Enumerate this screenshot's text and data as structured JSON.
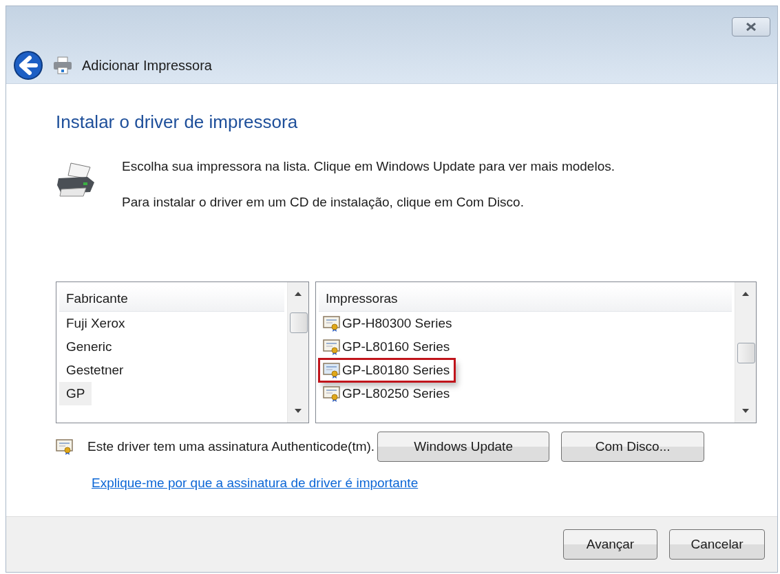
{
  "window": {
    "title": "Adicionar Impressora"
  },
  "heading": "Instalar o driver de impressora",
  "intro": [
    "Escolha sua impressora na lista. Clique em Windows Update para ver mais modelos.",
    "Para instalar o driver em um CD de instalação, clique em Com Disco."
  ],
  "manufacturers": {
    "header": "Fabricante",
    "items": [
      {
        "label": "Fuji Xerox",
        "selected": false
      },
      {
        "label": "Generic",
        "selected": false
      },
      {
        "label": "Gestetner",
        "selected": false
      },
      {
        "label": "GP",
        "selected": true
      }
    ]
  },
  "printers": {
    "header": "Impressoras",
    "items": [
      {
        "label": "GP-H80300 Series",
        "selected": false
      },
      {
        "label": "GP-L80160 Series",
        "selected": false
      },
      {
        "label": "GP-L80180 Series",
        "selected": true
      },
      {
        "label": "GP-L80250 Series",
        "selected": false
      }
    ]
  },
  "signature_note": "Este driver tem uma assinatura Authenticode(tm).",
  "buttons": [
    "Windows Update",
    "Com Disco..."
  ],
  "link": "Explique-me por que a assinatura de driver é importante",
  "footer_buttons": [
    "Avançar",
    "Cancelar"
  ]
}
